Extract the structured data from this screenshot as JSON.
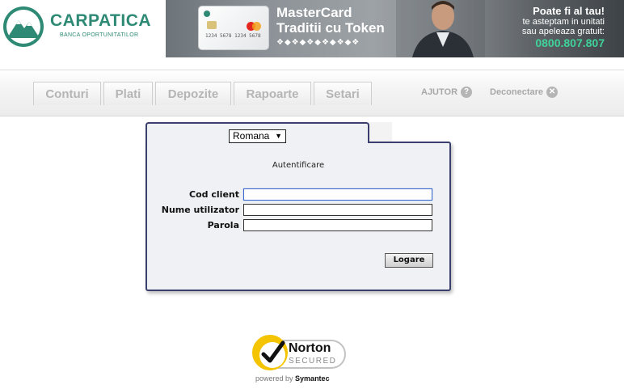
{
  "header": {
    "brand_name": "CARPATICA",
    "brand_tagline": "BANCA OPORTUNITATILOR",
    "colors": {
      "brand": "#2e8a74",
      "phone": "#3fd39a"
    }
  },
  "banner": {
    "title_line1": "MasterCard",
    "title_line2": "Traditii cu Token",
    "card_number": "1234 5678 1234 5678",
    "cta_line1": "Poate fi al tau!",
    "cta_line2": "te asteptam in unitati",
    "cta_line3": "sau apeleaza gratuit:",
    "phone": "0800.807.807"
  },
  "nav": {
    "tabs": [
      {
        "label": "Conturi"
      },
      {
        "label": "Plati"
      },
      {
        "label": "Depozite"
      },
      {
        "label": "Rapoarte"
      },
      {
        "label": "Setari"
      }
    ],
    "help_label": "AJUTOR",
    "help_icon": "question-circle-icon",
    "logout_label": "Deconectare",
    "logout_icon": "close-circle-icon"
  },
  "login": {
    "language_selected": "Romana",
    "title": "Autentificare",
    "fields": {
      "client_code_label": "Cod client",
      "client_code_value": "",
      "username_label": "Nume utilizator",
      "username_value": "",
      "password_label": "Parola",
      "password_value": ""
    },
    "submit_label": "Logare",
    "colors": {
      "panel_border": "#3b3f6e",
      "panel_bg": "#eff1f4"
    }
  },
  "norton": {
    "name": "Norton",
    "secured": "SECURED",
    "powered_prefix": "powered by",
    "powered_brand": "Symantec"
  }
}
